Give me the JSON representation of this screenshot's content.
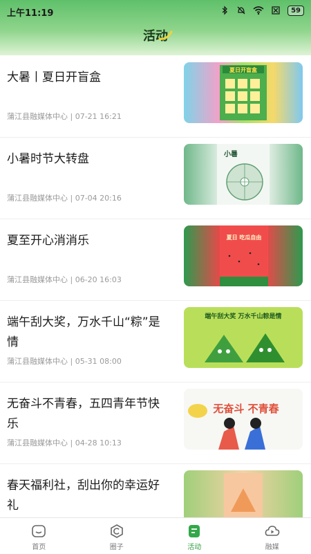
{
  "status_bar": {
    "time": "上午11:19",
    "battery": "59"
  },
  "header": {
    "title": "活动"
  },
  "items": [
    {
      "title": "大暑丨夏日开盲盒",
      "meta": "蒲江县融媒体中心 | 07-21 16:21",
      "thumb_text": "夏日开盲盒"
    },
    {
      "title": "小暑时节大转盘",
      "meta": "蒲江县融媒体中心 | 07-04 20:16",
      "thumb_text": "小暑"
    },
    {
      "title": "夏至开心消消乐",
      "meta": "蒲江县融媒体中心 | 06-20 16:03",
      "thumb_text": "夏日 吃瓜自由"
    },
    {
      "title": "端午刮大奖，万水千山“粽”是情",
      "meta": "蒲江县融媒体中心 | 05-31 08:00",
      "thumb_text": "端午刮大奖 万水千山粽是情"
    },
    {
      "title": "无奋斗不青春，五四青年节快乐",
      "meta": "蒲江县融媒体中心 | 04-28 10:13",
      "thumb_text": "无奋斗 不青春"
    },
    {
      "title": "春天福利社，刮出你的幸运好礼",
      "meta": "",
      "thumb_text": ""
    }
  ],
  "tabbar": [
    {
      "label": "首页",
      "icon": "home-icon",
      "active": false
    },
    {
      "label": "圈子",
      "icon": "circle-icon",
      "active": false
    },
    {
      "label": "活动",
      "icon": "activity-icon",
      "active": true
    },
    {
      "label": "融媒",
      "icon": "media-icon",
      "active": false
    }
  ],
  "colors": {
    "accent": "#2f9e3f",
    "header_green": "#5fc06a"
  }
}
